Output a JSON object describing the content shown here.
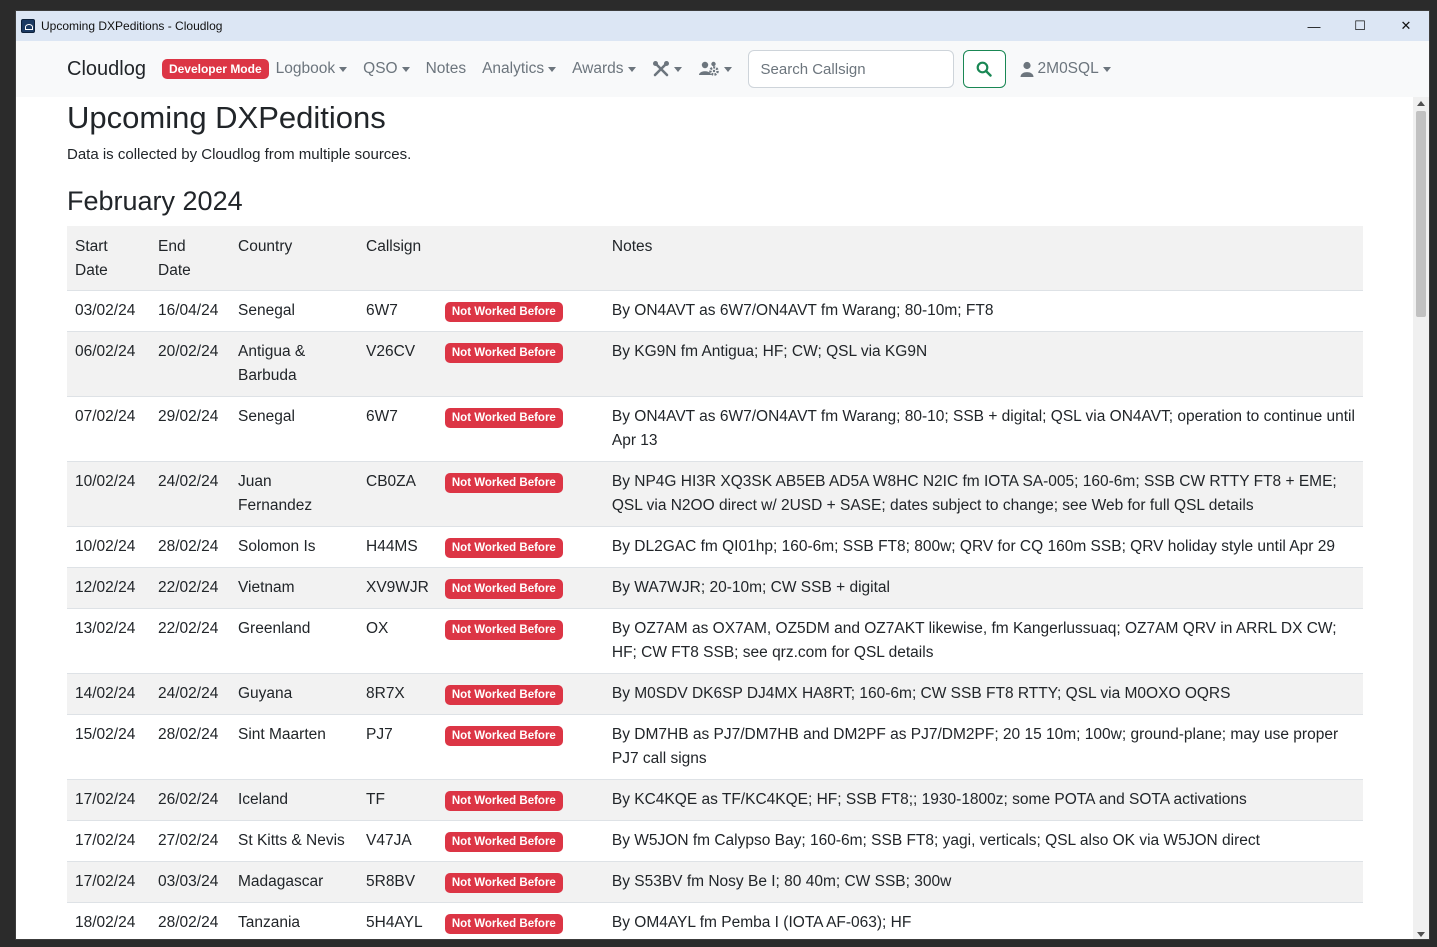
{
  "window": {
    "title": "Upcoming DXPeditions - Cloudlog",
    "controls": {
      "minimize": "—",
      "maximize": "☐",
      "close": "✕"
    }
  },
  "navbar": {
    "brand": "Cloudlog",
    "dev_badge": "Developer Mode",
    "menu": [
      "Logbook",
      "QSO",
      "Notes",
      "Analytics",
      "Awards"
    ],
    "icons": [
      "tools-icon",
      "users-cog-icon"
    ],
    "search_placeholder": "Search Callsign",
    "user": "2M0SQL"
  },
  "page": {
    "title": "Upcoming DXPeditions",
    "subtitle": "Data is collected by Cloudlog from multiple sources.",
    "section": "February 2024"
  },
  "table": {
    "headers": {
      "start": "Start Date",
      "end": "End Date",
      "country": "Country",
      "callsign": "Callsign",
      "notes": "Notes"
    },
    "rows": [
      {
        "start": "03/02/24",
        "end": "16/04/24",
        "country": "Senegal",
        "callsign": "6W7",
        "status": "Not Worked Before",
        "notes": "By ON4AVT as 6W7/ON4AVT fm Warang; 80-10m; FT8"
      },
      {
        "start": "06/02/24",
        "end": "20/02/24",
        "country": "Antigua & Barbuda",
        "callsign": "V26CV",
        "status": "Not Worked Before",
        "notes": "By KG9N fm Antigua; HF; CW; QSL via KG9N"
      },
      {
        "start": "07/02/24",
        "end": "29/02/24",
        "country": "Senegal",
        "callsign": "6W7",
        "status": "Not Worked Before",
        "notes": "By ON4AVT as 6W7/ON4AVT fm Warang; 80-10; SSB + digital; QSL via ON4AVT; operation to continue until Apr 13"
      },
      {
        "start": "10/02/24",
        "end": "24/02/24",
        "country": "Juan Fernandez",
        "callsign": "CB0ZA",
        "status": "Not Worked Before",
        "notes": "By NP4G HI3R XQ3SK AB5EB AD5A W8HC N2IC fm IOTA SA-005; 160-6m; SSB CW RTTY FT8 + EME; QSL via N2OO direct w/ 2USD + SASE; dates subject to change; see Web for full QSL details"
      },
      {
        "start": "10/02/24",
        "end": "28/02/24",
        "country": "Solomon Is",
        "callsign": "H44MS",
        "status": "Not Worked Before",
        "notes": "By DL2GAC fm QI01hp; 160-6m; SSB FT8; 800w; QRV for CQ 160m SSB; QRV holiday style until Apr 29"
      },
      {
        "start": "12/02/24",
        "end": "22/02/24",
        "country": "Vietnam",
        "callsign": "XV9WJR",
        "status": "Not Worked Before",
        "notes": "By WA7WJR; 20-10m; CW SSB + digital"
      },
      {
        "start": "13/02/24",
        "end": "22/02/24",
        "country": "Greenland",
        "callsign": "OX",
        "status": "Not Worked Before",
        "notes": "By OZ7AM as OX7AM, OZ5DM and OZ7AKT likewise, fm Kangerlussuaq; OZ7AM QRV in ARRL DX CW; HF; CW FT8 SSB; see qrz.com for QSL details"
      },
      {
        "start": "14/02/24",
        "end": "24/02/24",
        "country": "Guyana",
        "callsign": "8R7X",
        "status": "Not Worked Before",
        "notes": "By M0SDV DK6SP DJ4MX HA8RT; 160-6m; CW SSB FT8 RTTY; QSL via M0OXO OQRS"
      },
      {
        "start": "15/02/24",
        "end": "28/02/24",
        "country": "Sint Maarten",
        "callsign": "PJ7",
        "status": "Not Worked Before",
        "notes": "By DM7HB as PJ7/DM7HB and DM2PF as PJ7/DM2PF; 20 15 10m; 100w; ground-plane; may use proper PJ7 call signs"
      },
      {
        "start": "17/02/24",
        "end": "26/02/24",
        "country": "Iceland",
        "callsign": "TF",
        "status": "Not Worked Before",
        "notes": "By KC4KQE as TF/KC4KQE; HF; SSB FT8;; 1930-1800z; some POTA and SOTA activations"
      },
      {
        "start": "17/02/24",
        "end": "27/02/24",
        "country": "St Kitts & Nevis",
        "callsign": "V47JA",
        "status": "Not Worked Before",
        "notes": "By W5JON fm Calypso Bay; 160-6m; SSB FT8; yagi, verticals; QSL also OK via W5JON direct"
      },
      {
        "start": "17/02/24",
        "end": "03/03/24",
        "country": "Madagascar",
        "callsign": "5R8BV",
        "status": "Not Worked Before",
        "notes": "By S53BV fm Nosy Be I; 80 40m; CW SSB; 300w"
      },
      {
        "start": "18/02/24",
        "end": "28/02/24",
        "country": "Tanzania",
        "callsign": "5H4AYL",
        "status": "Not Worked Before",
        "notes": "By OM4AYL fm Pemba I (IOTA AF-063); HF"
      }
    ]
  }
}
